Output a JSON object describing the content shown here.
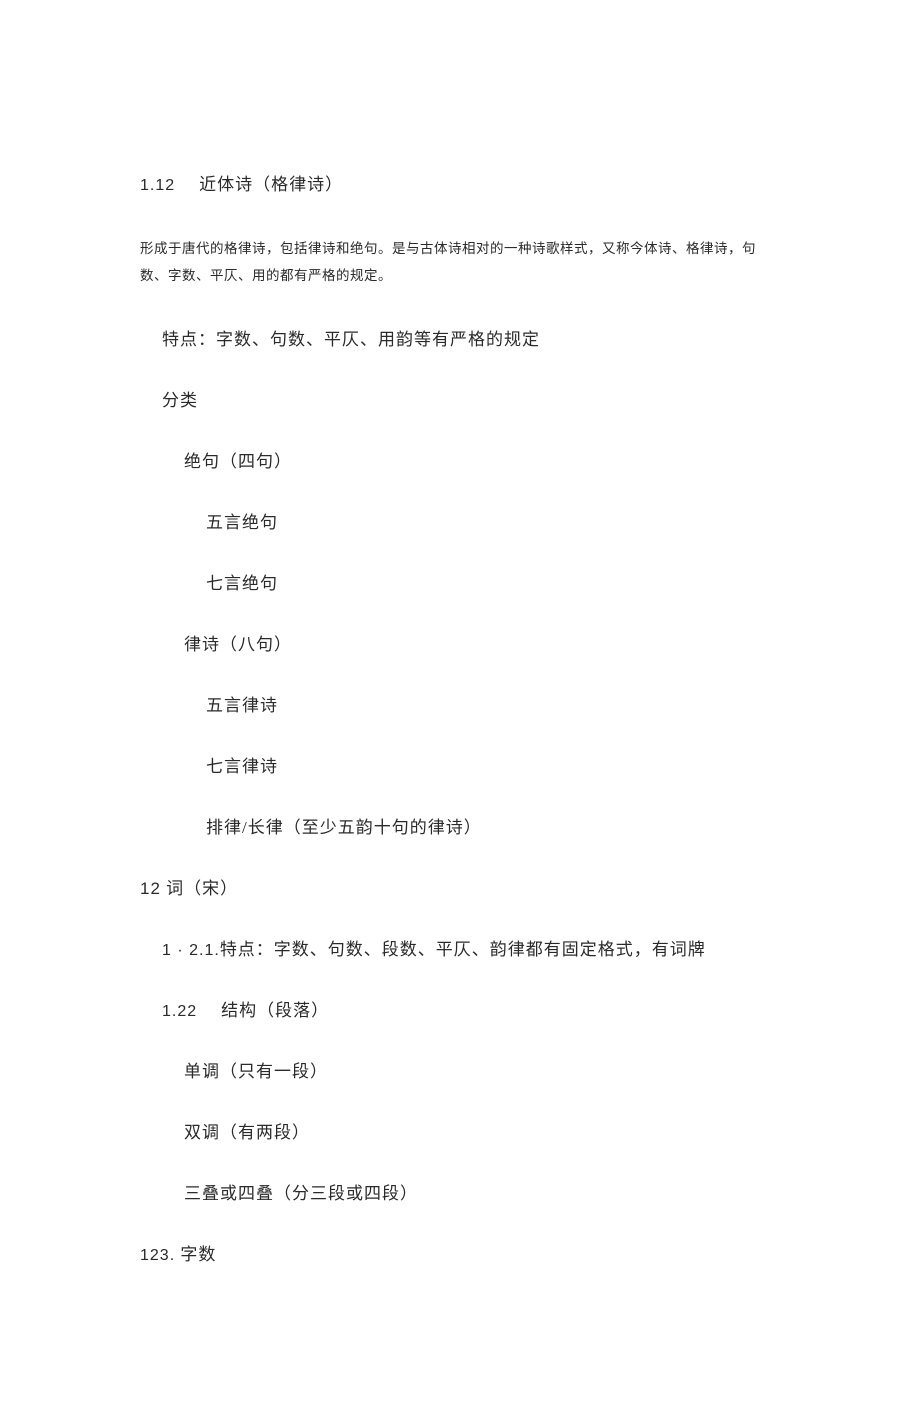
{
  "section1": {
    "number": "1.12",
    "title": "近体诗（格律诗）",
    "description": "形成于唐代的格律诗，包括律诗和绝句。是与古体诗相对的一种诗歌样式，又称今体诗、格律诗，句数、字数、平仄、用的都有严格的规定。",
    "feature": "特点：字数、句数、平仄、用韵等有严格的规定",
    "classification": "分类",
    "jueju": {
      "title": "绝句（四句）",
      "wuyan": "五言绝句",
      "qiyan": "七言绝句"
    },
    "lushi": {
      "title": "律诗（八句）",
      "wuyan": "五言律诗",
      "qiyan": "七言律诗",
      "pailu": "排律/长律（至少五韵十句的律诗）"
    }
  },
  "section2": {
    "number": "12",
    "title": "词（宋）",
    "feature_num": "1 · 2.1.",
    "feature": "特点：字数、句数、段数、平仄、韵律都有固定格式，有词牌",
    "structure": {
      "number": "1.22",
      "title": "结构（段落）",
      "dandiao": "单调（只有一段）",
      "shuangdiao": "双调（有两段）",
      "sandie": "三叠或四叠（分三段或四段）"
    },
    "zishu": {
      "number": "123.",
      "title": "字数"
    }
  }
}
